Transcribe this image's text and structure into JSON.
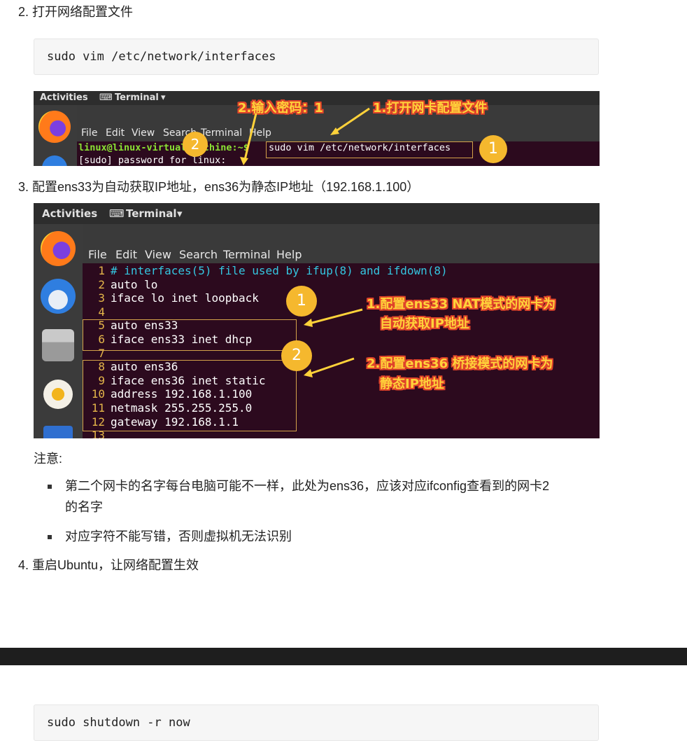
{
  "steps": {
    "s2": "2. 打开网络配置文件",
    "s3": "3. 配置ens33为自动获取IP地址，ens36为静态IP地址（192.168.1.100）",
    "s4": "4. 重启Ubuntu，让网络配置生效"
  },
  "code1": "sudo vim /etc/network/interfaces",
  "code2": "sudo shutdown -r now",
  "shot1": {
    "activities": "Activities",
    "terminal": "Terminal",
    "menu": [
      "File",
      "Edit",
      "View",
      "Search",
      "Terminal",
      "Help"
    ],
    "prompt": "linux@linux-virtual-machine:~$ ",
    "command": "sudo vim /etc/network/interfaces",
    "password_line": "[sudo] password for linux:",
    "anno1": "1.打开网卡配置文件",
    "anno2": "2.输入密码：1",
    "badge1": "1",
    "badge2": "2"
  },
  "shot2": {
    "activities": "Activities",
    "terminal": "Terminal",
    "menu": [
      "File",
      "Edit",
      "View",
      "Search",
      "Terminal",
      "Help"
    ],
    "lines": [
      {
        "n": "1",
        "t": "# interfaces(5) file used by ifup(8) and ifdown(8)"
      },
      {
        "n": "2",
        "t": "auto lo"
      },
      {
        "n": "3",
        "t": "iface lo inet loopback"
      },
      {
        "n": "4",
        "t": ""
      },
      {
        "n": "5",
        "t": "auto ens33"
      },
      {
        "n": "6",
        "t": "iface ens33 inet dhcp"
      },
      {
        "n": "7",
        "t": ""
      },
      {
        "n": "8",
        "t": "auto ens36"
      },
      {
        "n": "9",
        "t": "iface ens36 inet static"
      },
      {
        "n": "10",
        "t": "address 192.168.1.100"
      },
      {
        "n": "11",
        "t": "netmask 255.255.255.0"
      },
      {
        "n": "12",
        "t": "gateway 192.168.1.1"
      },
      {
        "n": "13",
        "t": ""
      }
    ],
    "anno1_line1": "1.配置ens33 NAT模式的网卡为",
    "anno1_line2": "自动获取IP地址",
    "anno2_line1": "2.配置ens36 桥接模式的网卡为",
    "anno2_line2": "静态IP地址",
    "badge1": "1",
    "badge2": "2"
  },
  "note": {
    "title": "注意:",
    "items": [
      "第二个网卡的名字每台电脑可能不一样，此处为ens36，应该对应ifconfig查看到的网卡2",
      "的名字",
      "对应字符不能写错，否则虚拟机无法识别"
    ]
  }
}
